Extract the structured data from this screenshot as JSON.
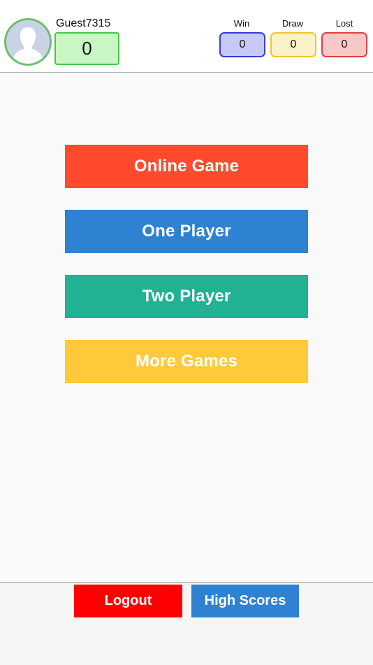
{
  "header": {
    "username": "Guest7315",
    "score": "0",
    "stats": {
      "win": {
        "label": "Win",
        "value": "0",
        "color": "#3b3bd6"
      },
      "draw": {
        "label": "Draw",
        "value": "0",
        "color": "#f2c232"
      },
      "lost": {
        "label": "Lost",
        "value": "0",
        "color": "#e04040"
      }
    },
    "avatar_icon": "person-silhouette-icon"
  },
  "menu": {
    "online_game": {
      "label": "Online Game",
      "color": "#ff4a2e"
    },
    "one_player": {
      "label": "One Player",
      "color": "#2f82d2"
    },
    "two_player": {
      "label": "Two Player",
      "color": "#21b193"
    },
    "more_games": {
      "label": "More Games",
      "color": "#fec93b"
    }
  },
  "footer": {
    "logout": {
      "label": "Logout",
      "color": "#ff0000"
    },
    "high_scores": {
      "label": "High Scores",
      "color": "#2f82d2"
    }
  }
}
